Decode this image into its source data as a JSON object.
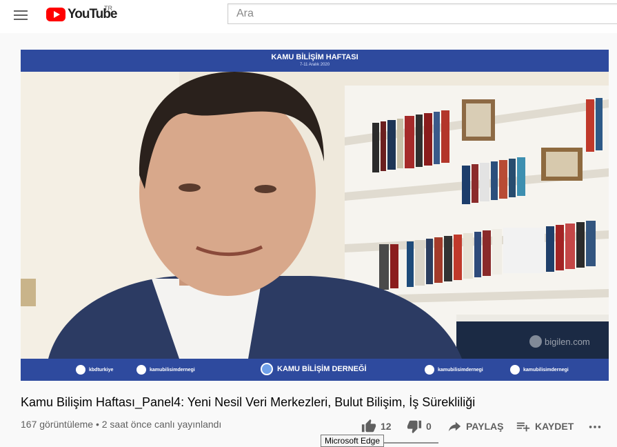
{
  "header": {
    "logo_text": "YouTube",
    "country_code": "TR",
    "search_placeholder": "Ara"
  },
  "video_frame": {
    "banner_title": "KAMU BİLİŞİM HAFTASI",
    "banner_date": "7-11 Aralık 2020",
    "footer": {
      "twitter": "kbdturkiye",
      "linkedin": "kamubilisimdernegi",
      "association": "KAMU BİLİŞİM DERNEĞİ",
      "instagram": "kamubilisimdernegi",
      "youtube": "kamubilisimdernegi"
    },
    "watermark": "bigilen.com"
  },
  "video": {
    "title": "Kamu Bilişim Haftası_Panel4: Yeni Nesil Veri Merkezleri, Bulut Bilişim, İş Sürekliliği",
    "meta": "167 görüntüleme • 2 saat önce canlı yayınlandı"
  },
  "actions": {
    "like_count": "12",
    "dislike_count": "0",
    "share_label": "PAYLAŞ",
    "save_label": "KAYDET"
  },
  "tooltip": "Microsoft Edge",
  "colors": {
    "brand_red": "#ff0000",
    "banner_blue": "#2e4a9e",
    "text_secondary": "#606060"
  }
}
